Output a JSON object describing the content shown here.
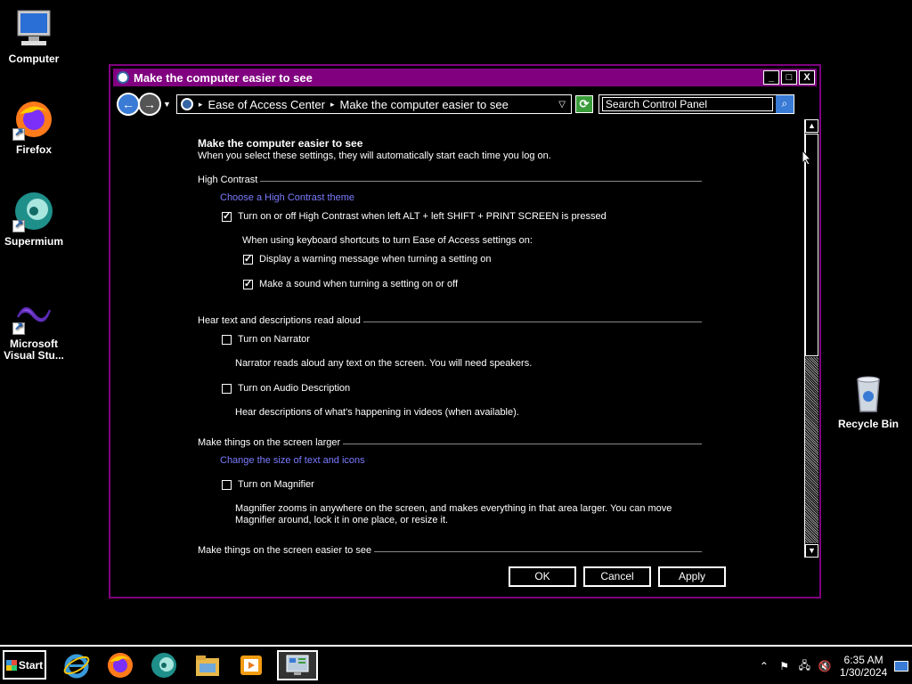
{
  "desktop": {
    "icons": [
      {
        "label": "Computer",
        "icon": "computer-icon"
      },
      {
        "label": "Firefox",
        "icon": "firefox-icon"
      },
      {
        "label": "Supermium",
        "icon": "supermium-icon"
      },
      {
        "label": "Microsoft Visual Stu...",
        "icon": "visual-studio-icon"
      },
      {
        "label": "Recycle Bin",
        "icon": "recycle-bin-icon"
      }
    ]
  },
  "window": {
    "title": "Make the computer easier to see",
    "controls": {
      "minimize": "_",
      "maximize": "□",
      "close": "X"
    },
    "breadcrumb": {
      "item1": "Ease of Access Center",
      "item2": "Make the computer easier to see"
    },
    "search": {
      "placeholder": "Search Control Panel"
    },
    "page": {
      "heading": "Make the computer easier to see",
      "subheading": "When you select these settings, they will automatically start each time you log on.",
      "high_contrast": {
        "group": "High Contrast",
        "link": "Choose a High Contrast theme",
        "toggle_label": "Turn on or off High Contrast when left ALT + left SHIFT + PRINT SCREEN is pressed",
        "toggle_checked": true,
        "shortcut_note": "When using keyboard shortcuts to turn Ease of Access settings on:",
        "warning_label": "Display a warning message when turning a setting on",
        "warning_checked": true,
        "sound_label": "Make a sound when turning a setting on or off",
        "sound_checked": true
      },
      "hear_text": {
        "group": "Hear text and descriptions read aloud",
        "narrator_label": "Turn on Narrator",
        "narrator_checked": false,
        "narrator_desc": "Narrator reads aloud any text on the screen. You will need speakers.",
        "audio_desc_label": "Turn on Audio Description",
        "audio_desc_checked": false,
        "audio_desc_desc": "Hear descriptions of what's happening in videos (when available)."
      },
      "larger": {
        "group": "Make things on the screen larger",
        "link": "Change the size of text and icons",
        "magnifier_label": "Turn on Magnifier",
        "magnifier_checked": false,
        "magnifier_desc": "Magnifier zooms in anywhere on the screen, and makes everything in that area larger. You can move Magnifier around, lock it in one place, or resize it."
      },
      "easier": {
        "group": "Make things on the screen easier to see"
      }
    },
    "buttons": {
      "ok": "OK",
      "cancel": "Cancel",
      "apply": "Apply"
    }
  },
  "taskbar": {
    "start_label": "Start",
    "apps": [
      "internet-explorer-icon",
      "firefox-icon",
      "supermium-icon",
      "file-explorer-icon",
      "media-player-icon",
      "control-panel-icon"
    ],
    "clock": {
      "time": "6:35 AM",
      "date": "1/30/2024"
    }
  },
  "colors": {
    "titlebar": "#800080",
    "link": "#7b7bff"
  }
}
